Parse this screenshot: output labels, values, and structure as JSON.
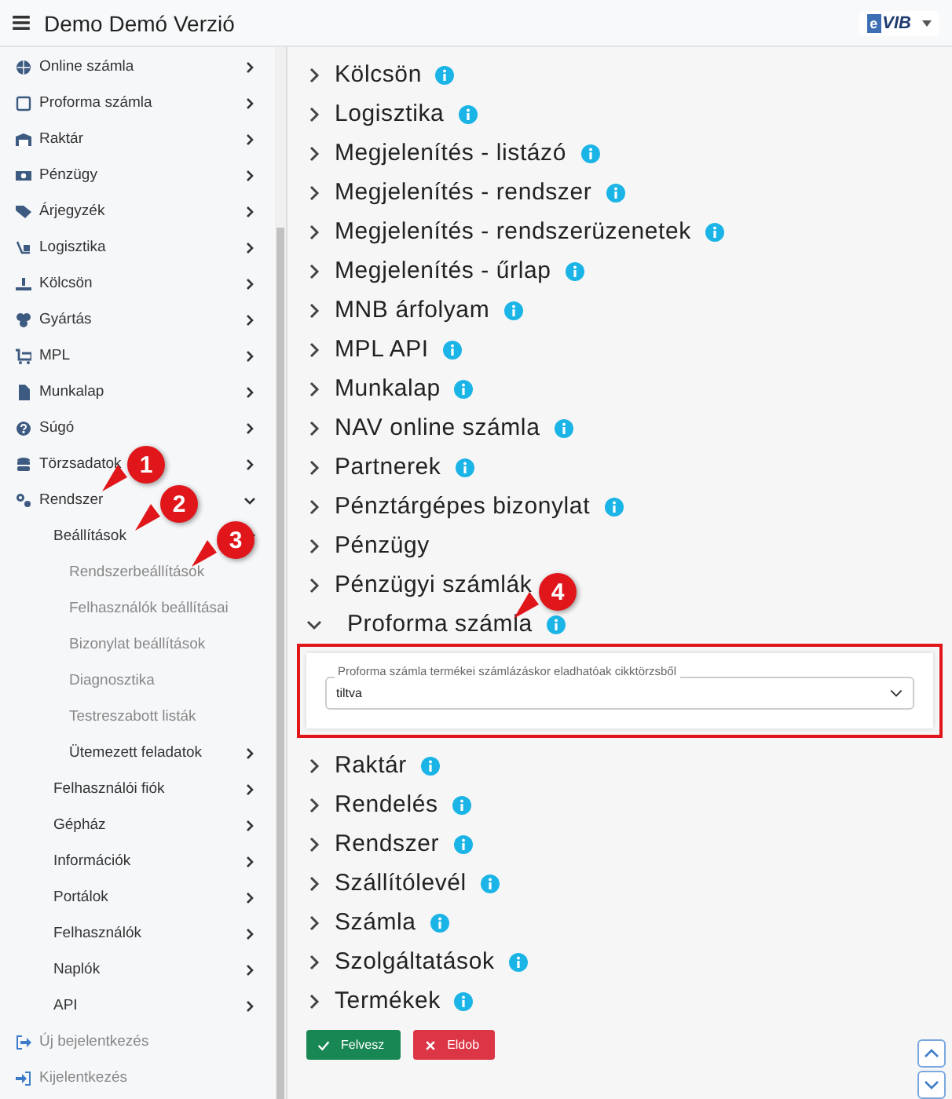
{
  "header": {
    "title": "Demo Demó Verzió",
    "logo": {
      "badge": "e",
      "text": "VIB"
    }
  },
  "sidebar": {
    "items": [
      {
        "label": "Online számla",
        "kind": "group",
        "expanded": false
      },
      {
        "label": "Proforma számla",
        "kind": "group",
        "expanded": false
      },
      {
        "label": "Raktár",
        "kind": "group",
        "expanded": false
      },
      {
        "label": "Pénzügy",
        "kind": "group",
        "expanded": false
      },
      {
        "label": "Árjegyzék",
        "kind": "group",
        "expanded": false
      },
      {
        "label": "Logisztika",
        "kind": "group",
        "expanded": false
      },
      {
        "label": "Kölcsön",
        "kind": "group",
        "expanded": false
      },
      {
        "label": "Gyártás",
        "kind": "group",
        "expanded": false
      },
      {
        "label": "MPL",
        "kind": "group",
        "expanded": false
      },
      {
        "label": "Munkalap",
        "kind": "group",
        "expanded": false
      },
      {
        "label": "Súgó",
        "kind": "group",
        "expanded": false
      },
      {
        "label": "Törzsadatok",
        "kind": "group",
        "expanded": false
      },
      {
        "label": "Rendszer",
        "kind": "group",
        "expanded": true,
        "children": [
          {
            "label": "Beállítások",
            "kind": "group",
            "expanded": true,
            "children": [
              {
                "label": "Rendszerbeállítások",
                "kind": "page"
              },
              {
                "label": "Felhasználók beállításai",
                "kind": "page"
              },
              {
                "label": "Bizonylat beállítások",
                "kind": "page"
              },
              {
                "label": "Diagnosztika",
                "kind": "page"
              },
              {
                "label": "Testreszabott listák",
                "kind": "page"
              },
              {
                "label": "Ütemezett feladatok",
                "kind": "group",
                "expanded": false
              }
            ]
          },
          {
            "label": "Felhasználói fiók",
            "kind": "group",
            "expanded": false
          },
          {
            "label": "Gépház",
            "kind": "group",
            "expanded": false
          },
          {
            "label": "Információk",
            "kind": "group",
            "expanded": false
          },
          {
            "label": "Portálok",
            "kind": "group",
            "expanded": false
          },
          {
            "label": "Felhasználók",
            "kind": "group",
            "expanded": false
          },
          {
            "label": "Naplók",
            "kind": "group",
            "expanded": false
          },
          {
            "label": "API",
            "kind": "group",
            "expanded": false
          }
        ]
      },
      {
        "label": "Új bejelentkezés",
        "kind": "action"
      },
      {
        "label": "Kijelentkezés",
        "kind": "action"
      }
    ]
  },
  "sections": [
    {
      "label": "Kölcsön",
      "info": true,
      "expanded": false
    },
    {
      "label": "Logisztika",
      "info": true,
      "expanded": false
    },
    {
      "label": "Megjelenítés - listázó",
      "info": true,
      "expanded": false
    },
    {
      "label": "Megjelenítés - rendszer",
      "info": true,
      "expanded": false
    },
    {
      "label": "Megjelenítés - rendszerüzenetek",
      "info": true,
      "expanded": false
    },
    {
      "label": "Megjelenítés - űrlap",
      "info": true,
      "expanded": false
    },
    {
      "label": "MNB árfolyam",
      "info": true,
      "expanded": false
    },
    {
      "label": "MPL API",
      "info": true,
      "expanded": false
    },
    {
      "label": "Munkalap",
      "info": true,
      "expanded": false
    },
    {
      "label": "NAV online számla",
      "info": true,
      "expanded": false
    },
    {
      "label": "Partnerek",
      "info": true,
      "expanded": false
    },
    {
      "label": "Pénztárgépes bizonylat",
      "info": true,
      "expanded": false
    },
    {
      "label": "Pénzügy",
      "info": false,
      "expanded": false
    },
    {
      "label": "Pénzügyi számlák",
      "info": false,
      "expanded": false
    },
    {
      "label": "Proforma számla",
      "info": true,
      "expanded": true,
      "highlighted": true,
      "fields": [
        {
          "label": "Proforma számla termékei számlázáskor eladhatóak cikktörzsből",
          "value": "tiltva"
        }
      ]
    },
    {
      "label": "Raktár",
      "info": true,
      "expanded": false
    },
    {
      "label": "Rendelés",
      "info": true,
      "expanded": false
    },
    {
      "label": "Rendszer",
      "info": true,
      "expanded": false
    },
    {
      "label": "Szállítólevél",
      "info": true,
      "expanded": false
    },
    {
      "label": "Számla",
      "info": true,
      "expanded": false
    },
    {
      "label": "Szolgáltatások",
      "info": true,
      "expanded": false
    },
    {
      "label": "Termékek",
      "info": true,
      "expanded": false
    }
  ],
  "buttons": [
    {
      "label": "Felvesz",
      "kind": "save"
    },
    {
      "label": "Eldob",
      "kind": "discard"
    }
  ],
  "callouts": [
    "1",
    "2",
    "3",
    "4"
  ]
}
